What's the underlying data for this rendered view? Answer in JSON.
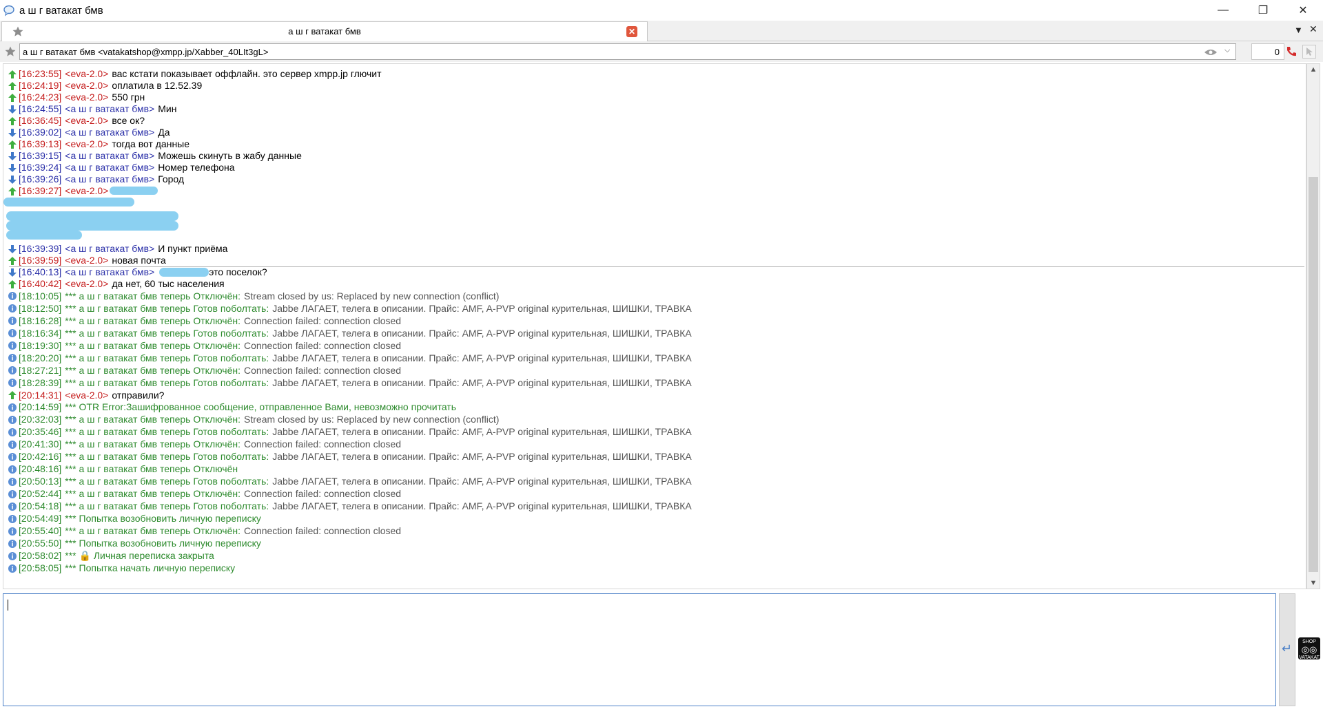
{
  "window": {
    "title": "а ш г ватакат бмв",
    "controls": {
      "minimize": "—",
      "restore": "❐",
      "close": "✕"
    }
  },
  "tab": {
    "title": "а ш г ватакат бмв",
    "close": "✕",
    "menu": "▼",
    "close_all": "✕"
  },
  "address": {
    "value": "а ш г ватакат бмв <vatakatshop@xmpp.jp/Xabber_40LIt3gL>",
    "dropdown": "⌵",
    "counter": "0"
  },
  "colors": {
    "incoming": "#2a2fa8",
    "outgoing": "#c51d1d",
    "system": "#2e8b2e",
    "accent": "#4a7fc7"
  },
  "messages": [
    {
      "type": "out",
      "ts": "[16:23:55]",
      "nick": "<eva-2.0>",
      "text": "вас кстати показывает оффлайн. это сервер xmpp.jp глючит"
    },
    {
      "type": "out",
      "ts": "[16:24:19]",
      "nick": "<eva-2.0>",
      "text": "оплатила в 12.52.39"
    },
    {
      "type": "out",
      "ts": "[16:24:23]",
      "nick": "<eva-2.0>",
      "text": "550 грн"
    },
    {
      "type": "in",
      "ts": "[16:24:55]",
      "nick": "<а ш г ватакат бмв>",
      "text": "Мин"
    },
    {
      "type": "out",
      "ts": "[16:36:45]",
      "nick": "<eva-2.0>",
      "text": "все ок?"
    },
    {
      "type": "in",
      "ts": "[16:39:02]",
      "nick": "<а ш г ватакат бмв>",
      "text": "Да"
    },
    {
      "type": "out",
      "ts": "[16:39:13]",
      "nick": "<eva-2.0>",
      "text": "тогда вот данные"
    },
    {
      "type": "in",
      "ts": "[16:39:15]",
      "nick": "<а ш г ватакат бмв>",
      "text": "Можешь скинуть в жабу данные"
    },
    {
      "type": "in",
      "ts": "[16:39:24]",
      "nick": "<а ш г ватакат бмв>",
      "text": "Номер телефона"
    },
    {
      "type": "in",
      "ts": "[16:39:26]",
      "nick": "<а ш г ватакат бмв>",
      "text": "Город"
    },
    {
      "type": "out",
      "ts": "[16:39:27]",
      "nick": "<eva-2.0>",
      "text": ""
    },
    {
      "type": "in",
      "ts": "[16:39:39]",
      "nick": "<а ш г ватакат бмв>",
      "text": "И пункт приёма"
    },
    {
      "type": "out",
      "ts": "[16:39:59]",
      "nick": "<eva-2.0>",
      "text": "новая почта"
    },
    {
      "type": "in",
      "ts": "[16:40:13]",
      "nick": "<а ш г ватакат бмв>",
      "text": "это поселок?"
    },
    {
      "type": "out",
      "ts": "[16:40:42]",
      "nick": "<eva-2.0>",
      "text": "да нет, 60 тыс населения"
    },
    {
      "type": "sys",
      "ts": "[18:10:05]",
      "text": "*** а ш г ватакат бмв теперь Отключён:",
      "extra": "Stream closed by us: Replaced by new connection (conflict)"
    },
    {
      "type": "sys",
      "ts": "[18:12:50]",
      "text": "*** а ш г ватакат бмв теперь Готов поболтать:",
      "extra": "Jabbe ЛАГАЕТ, телега в описании. Прайс: AMF, A-PVP original курительная, ШИШКИ, ТРАВКА"
    },
    {
      "type": "sys",
      "ts": "[18:16:28]",
      "text": "*** а ш г ватакат бмв теперь Отключён:",
      "extra": "Connection failed: connection closed"
    },
    {
      "type": "sys",
      "ts": "[18:16:34]",
      "text": "*** а ш г ватакат бмв теперь Готов поболтать:",
      "extra": "Jabbe ЛАГАЕТ, телега в описании. Прайс: AMF, A-PVP original курительная, ШИШКИ, ТРАВКА"
    },
    {
      "type": "sys",
      "ts": "[18:19:30]",
      "text": "*** а ш г ватакат бмв теперь Отключён:",
      "extra": "Connection failed: connection closed"
    },
    {
      "type": "sys",
      "ts": "[18:20:20]",
      "text": "*** а ш г ватакат бмв теперь Готов поболтать:",
      "extra": "Jabbe ЛАГАЕТ, телега в описании. Прайс: AMF, A-PVP original курительная, ШИШКИ, ТРАВКА"
    },
    {
      "type": "sys",
      "ts": "[18:27:21]",
      "text": "*** а ш г ватакат бмв теперь Отключён:",
      "extra": "Connection failed: connection closed"
    },
    {
      "type": "sys",
      "ts": "[18:28:39]",
      "text": "*** а ш г ватакат бмв теперь Готов поболтать:",
      "extra": "Jabbe ЛАГАЕТ, телега в описании. Прайс: AMF, A-PVP original курительная, ШИШКИ, ТРАВКА"
    },
    {
      "type": "out",
      "ts": "[20:14:31]",
      "nick": "<eva-2.0>",
      "text": "отправили?"
    },
    {
      "type": "sys",
      "ts": "[20:14:59]",
      "text": "*** OTR Error:Зашифрованное сообщение, отправленное Вами, невозможно прочитать",
      "extra": ""
    },
    {
      "type": "sys",
      "ts": "[20:32:03]",
      "text": "*** а ш г ватакат бмв теперь Отключён:",
      "extra": "Stream closed by us: Replaced by new connection (conflict)"
    },
    {
      "type": "sys",
      "ts": "[20:35:46]",
      "text": "*** а ш г ватакат бмв теперь Готов поболтать:",
      "extra": "Jabbe ЛАГАЕТ, телега в описании. Прайс: AMF, A-PVP original курительная, ШИШКИ, ТРАВКА"
    },
    {
      "type": "sys",
      "ts": "[20:41:30]",
      "text": "*** а ш г ватакат бмв теперь Отключён:",
      "extra": "Connection failed: connection closed"
    },
    {
      "type": "sys",
      "ts": "[20:42:16]",
      "text": "*** а ш г ватакат бмв теперь Готов поболтать:",
      "extra": "Jabbe ЛАГАЕТ, телега в описании. Прайс: AMF, A-PVP original курительная, ШИШКИ, ТРАВКА"
    },
    {
      "type": "sys",
      "ts": "[20:48:16]",
      "text": "*** а ш г ватакат бмв теперь Отключён",
      "extra": ""
    },
    {
      "type": "sys",
      "ts": "[20:50:13]",
      "text": "*** а ш г ватакат бмв теперь Готов поболтать:",
      "extra": "Jabbe ЛАГАЕТ, телега в описании. Прайс: AMF, A-PVP original курительная, ШИШКИ, ТРАВКА"
    },
    {
      "type": "sys",
      "ts": "[20:52:44]",
      "text": "*** а ш г ватакат бмв теперь Отключён:",
      "extra": "Connection failed: connection closed"
    },
    {
      "type": "sys",
      "ts": "[20:54:18]",
      "text": "*** а ш г ватакат бмв теперь Готов поболтать:",
      "extra": "Jabbe ЛАГАЕТ, телега в описании. Прайс: AMF, A-PVP original курительная, ШИШКИ, ТРАВКА"
    },
    {
      "type": "sys",
      "ts": "[20:54:49]",
      "text": "*** Попытка возобновить личную переписку",
      "extra": ""
    },
    {
      "type": "sys",
      "ts": "[20:55:40]",
      "text": "*** а ш г ватакат бмв теперь Отключён:",
      "extra": "Connection failed: connection closed"
    },
    {
      "type": "sys",
      "ts": "[20:55:50]",
      "text": "*** Попытка возобновить личную переписку",
      "extra": ""
    },
    {
      "type": "sys",
      "ts": "[20:58:02]",
      "text": "*** 🔒 Личная переписка закрыта",
      "extra": ""
    },
    {
      "type": "sys",
      "ts": "[20:58:05]",
      "text": "*** Попытка начать личную переписку",
      "extra": ""
    }
  ],
  "composer": {
    "value": "",
    "send": "↵"
  },
  "avatar": {
    "top": "SHOP",
    "bottom": "VATAKAT"
  }
}
